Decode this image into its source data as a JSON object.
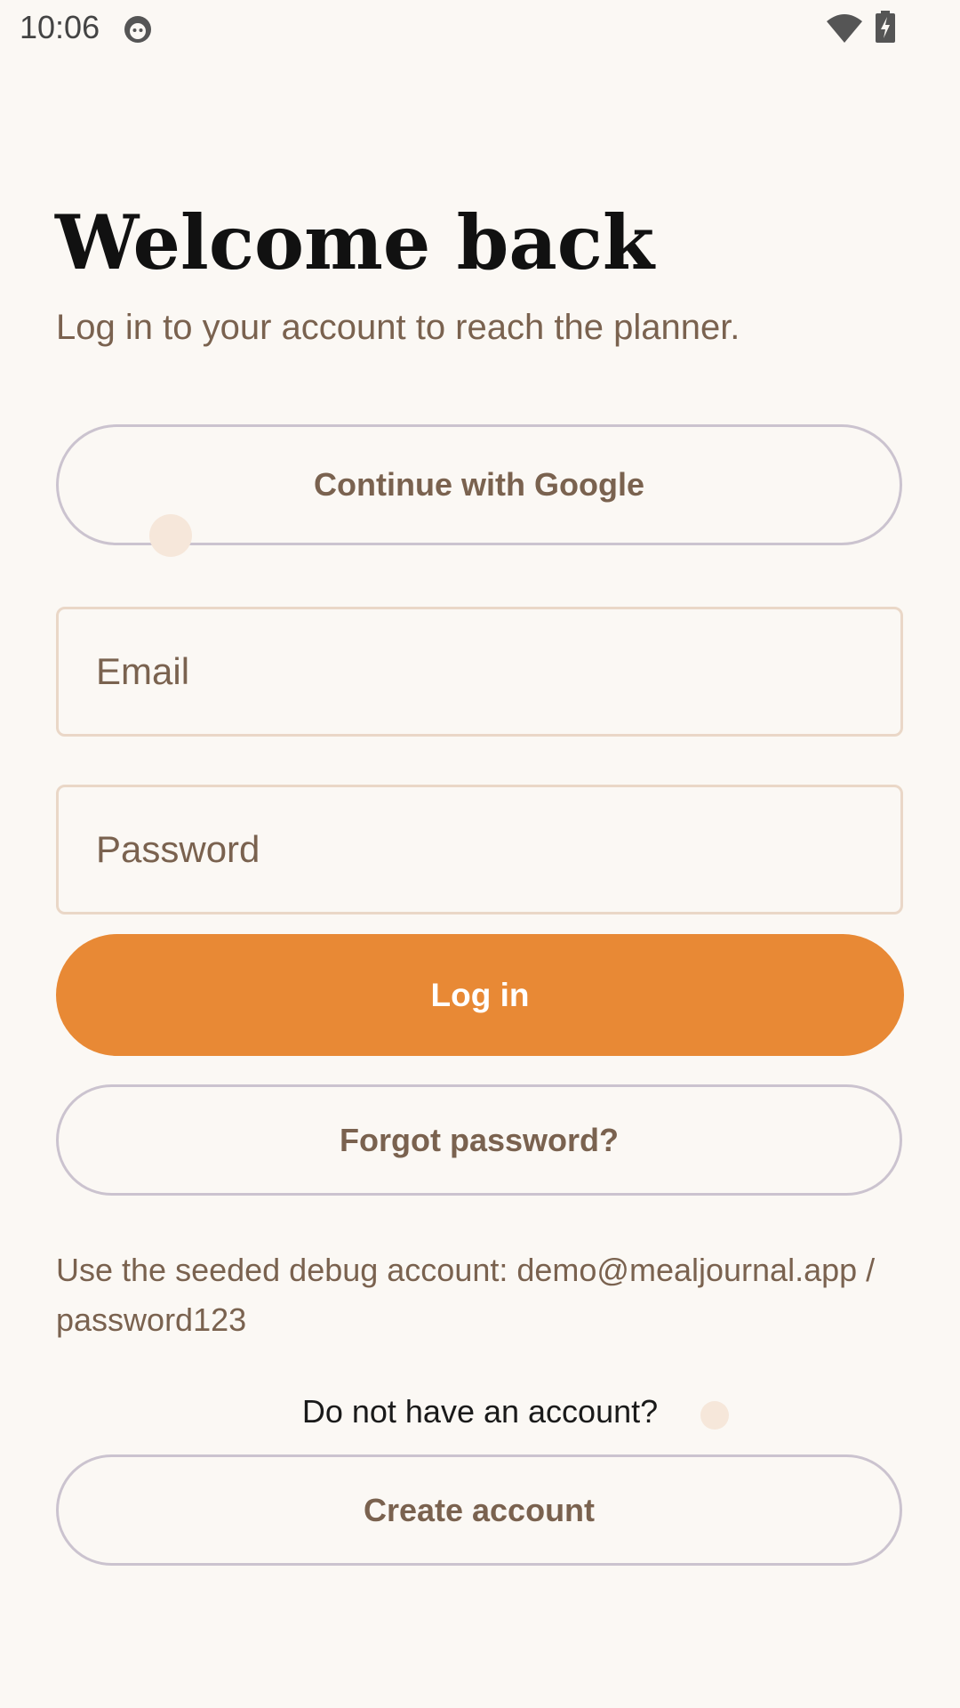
{
  "status_bar": {
    "time": "10:06",
    "app_icon": "android-debug-icon",
    "wifi_icon": "wifi-icon",
    "battery_icon": "battery-charging-icon"
  },
  "header": {
    "title": "Welcome back",
    "subtitle": "Log in to your account to reach the planner."
  },
  "form": {
    "google_button_label": "Continue with Google",
    "email_placeholder": "Email",
    "password_placeholder": "Password",
    "login_button_label": "Log in",
    "forgot_button_label": "Forgot password?",
    "debug_note": "Use the seeded debug account: demo@mealjournal.app / password123"
  },
  "footer": {
    "no_account_text": "Do not have an account?",
    "create_account_label": "Create account"
  },
  "colors": {
    "background": "#fbf8f4",
    "primary": "#e88935",
    "muted_text": "#7a624f",
    "outline": "#cbc3cf"
  }
}
